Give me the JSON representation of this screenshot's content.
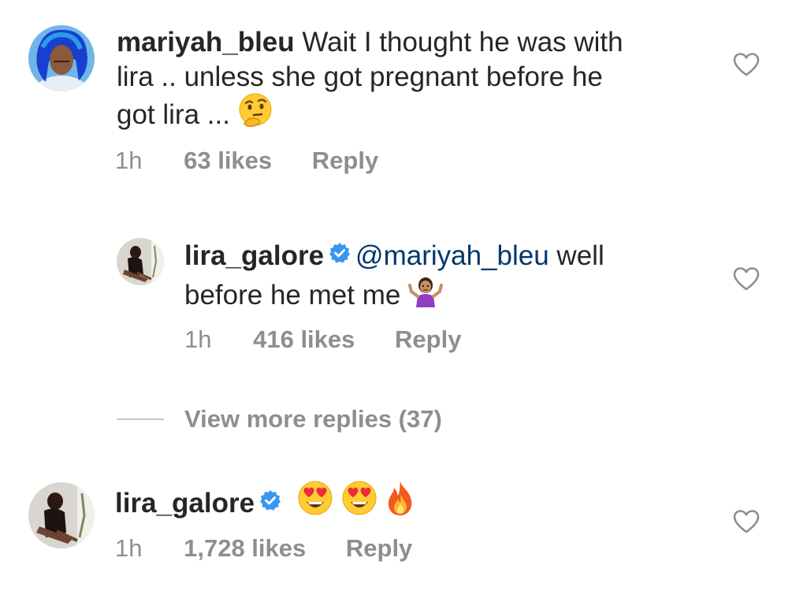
{
  "comments": [
    {
      "username": "mariyah_bleu",
      "verified": false,
      "text_line1": "Wait I thought he was with",
      "text_line2": "lira .. unless she got pregnant before he",
      "text_line3": "got lira ...",
      "emoji": "thinking-face",
      "time": "1h",
      "likes": "63 likes",
      "reply": "Reply"
    },
    {
      "username": "lira_galore",
      "verified": true,
      "mention": "@mariyah_bleu",
      "text_after_mention": " well",
      "text_line2": "before he met me",
      "emoji": "person-shrugging",
      "time": "1h",
      "likes": "416 likes",
      "reply": "Reply"
    },
    {
      "username": "lira_galore",
      "verified": true,
      "emojis": [
        "heart-eyes",
        "heart-eyes",
        "fire"
      ],
      "time": "1h",
      "likes": "1,728 likes",
      "reply": "Reply"
    }
  ],
  "view_more_replies": "View more replies (37)",
  "colors": {
    "text": "#262626",
    "meta": "#8e8e8e",
    "mention": "#00376b",
    "verified": "#3897f0"
  }
}
